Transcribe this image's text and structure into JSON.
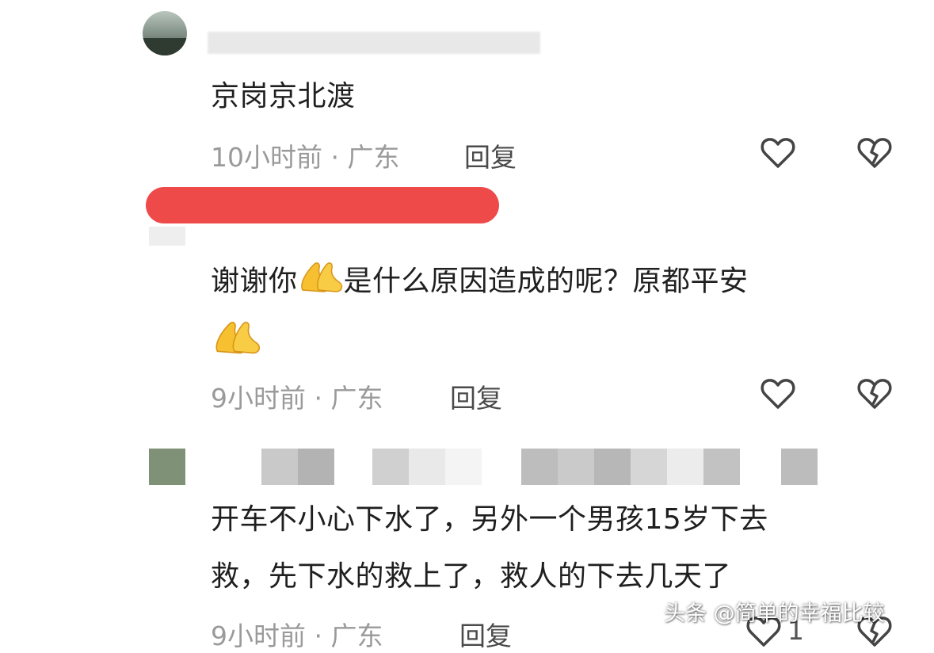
{
  "comments": [
    {
      "text": "京岗京北渡",
      "time": "10小时前 · 广东",
      "reply_label": "回复"
    },
    {
      "text": "谢谢你",
      "text_rest": "是什么原因造成的呢？原都平安",
      "time": "9小时前 · 广东",
      "reply_label": "回复"
    },
    {
      "text_line1": "开车不小心下水了，另外一个男孩15岁下去",
      "text_line2": "救，先下水的救上了，救人的下去几天了",
      "time": "9小时前 · 广东",
      "reply_label": "回复",
      "like_count": "1"
    }
  ],
  "watermark": "头条 @简单的幸福比较"
}
